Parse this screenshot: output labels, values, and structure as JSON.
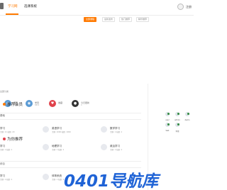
{
  "nav": {
    "items": [
      {
        "label": "学习网",
        "active": true
      },
      {
        "label": "选课系统",
        "active": false
      }
    ],
    "login": "注册"
  },
  "filters": [
    {
      "label": "全部课程",
      "active": true
    },
    {
      "label": "最新发布",
      "active": false
    },
    {
      "label": "热门推荐",
      "active": false
    },
    {
      "label": "精华推荐",
      "active": false
    }
  ],
  "main": {
    "caption": "全部分类",
    "stats": [
      {
        "label": "课程",
        "sub": "2048",
        "color": "#5b9bd5",
        "icon": "globe-icon"
      },
      {
        "label": "学员",
        "sub": "8811",
        "color": "#5b9bd5",
        "icon": "group-icon"
      },
      {
        "label": "收藏",
        "sub": "",
        "color": "#e0424b",
        "icon": "heart-icon"
      },
      {
        "label": "今日更新",
        "sub": "0",
        "color": "#333333",
        "icon": "user-icon"
      }
    ],
    "groups": [
      {
        "title": "基础",
        "courses": [
          {
            "name": "学习",
            "meta": "主题: 11 帖数: 20"
          },
          {
            "name": "英语学习",
            "meta": "主题: 1000 帖数: 1000"
          },
          {
            "name": "数学学习",
            "meta": "主题: 1 帖数: 1"
          },
          {
            "name": "学习",
            "meta": "主题: 1 帖数: 1"
          },
          {
            "name": "地理学习",
            "meta": "主题: 1 帖数: 1"
          },
          {
            "name": "政治学习",
            "meta": "主题: 1 帖数: 1"
          }
        ]
      },
      {
        "title": "综合",
        "courses": [
          {
            "name": "学习",
            "meta": "主题: 1 帖数: 1"
          },
          {
            "name": "体育系统",
            "meta": "主题: 1 帖数: 1"
          }
        ]
      }
    ]
  },
  "sidebar": {
    "members_title": "推荐会员",
    "members": [
      "user",
      "admin",
      "demo",
      "test",
      "李思"
    ],
    "recommend_title": "为你推荐"
  },
  "watermark": "0401导航库",
  "colors": {
    "accent": "#ff7a00",
    "watermark": "#1f63d6"
  }
}
